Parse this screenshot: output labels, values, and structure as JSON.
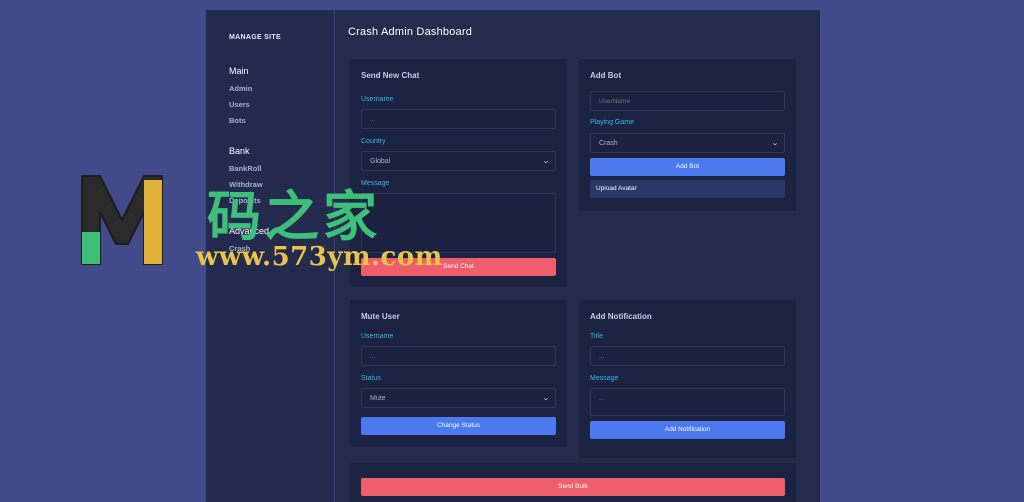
{
  "sidebar": {
    "brand": "MANAGE SITE",
    "groups": [
      {
        "title": "Main",
        "items": [
          "Admin",
          "Users",
          "Bots"
        ]
      },
      {
        "title": "Bank",
        "items": [
          "BankRoll",
          "Withdraw",
          "Deposits"
        ]
      },
      {
        "title": "Advanced",
        "items": [
          "Crash"
        ]
      }
    ]
  },
  "main": {
    "title": "Crash Admin Dashboard",
    "send_chat": {
      "title": "Send New Chat",
      "username_label": "Username",
      "username_placeholder": "...",
      "country_label": "Country",
      "country_value": "Global",
      "message_label": "Message",
      "message_placeholder": "...",
      "button": "Send Chat"
    },
    "add_bot": {
      "title": "Add Bot",
      "username_placeholder": "UserName",
      "game_label": "Playing Game",
      "game_value": "Crash",
      "button": "Add Bot",
      "upload": "Upload Avatar"
    },
    "mute_user": {
      "title": "Mute User",
      "username_label": "Username",
      "username_placeholder": "...",
      "status_label": "Status",
      "status_value": "Mute",
      "button": "Change Status"
    },
    "notification": {
      "title": "Add Notification",
      "title_label": "Title",
      "title_placeholder": "...",
      "message_label": "Message",
      "message_placeholder": "...",
      "button": "Add Notification"
    },
    "bulk": {
      "button": "Send Bulk"
    }
  },
  "watermark": {
    "chars": "码之家",
    "url": "www.573ym.com"
  },
  "colors": {
    "page_bg": "#434a8a",
    "panel_bg": "#232a4e",
    "card_bg": "#1b2242",
    "accent_blue": "#4c78f0",
    "accent_red": "#ef5f6b",
    "label_cyan": "#39b6e8"
  }
}
